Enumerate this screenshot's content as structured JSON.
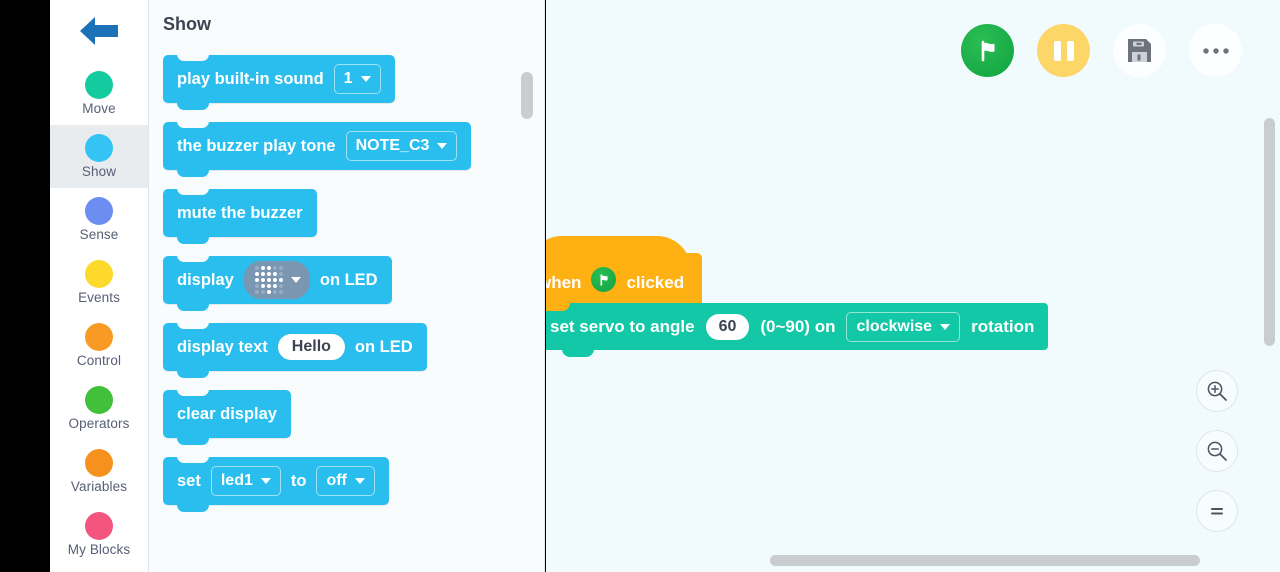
{
  "app": {
    "back_icon": "back-arrow-icon"
  },
  "sidebar": {
    "items": [
      {
        "label": "Move",
        "color": "#14ca9f",
        "active": false
      },
      {
        "label": "Show",
        "color": "#35c3f3",
        "active": true
      },
      {
        "label": "Sense",
        "color": "#6b8ef0",
        "active": false
      },
      {
        "label": "Events",
        "color": "#fcd92b",
        "active": false
      },
      {
        "label": "Control",
        "color": "#f99a24",
        "active": false
      },
      {
        "label": "Operators",
        "color": "#42bf3b",
        "active": false
      },
      {
        "label": "Variables",
        "color": "#f7911e",
        "active": false
      },
      {
        "label": "My Blocks",
        "color": "#f4557f",
        "active": false
      }
    ]
  },
  "palette": {
    "title": "Show",
    "blocks": [
      {
        "id": "play-built-in-sound",
        "pre": "play built-in sound",
        "field_type": "dropdown",
        "field_value": "1",
        "post": ""
      },
      {
        "id": "buzzer-play-tone",
        "pre": "the buzzer play tone",
        "field_type": "dropdown",
        "field_value": "NOTE_C3",
        "post": ""
      },
      {
        "id": "mute-the-buzzer",
        "pre": "mute the buzzer",
        "field_type": "none",
        "field_value": "",
        "post": ""
      },
      {
        "id": "display-on-led",
        "pre": "display",
        "field_type": "matrix",
        "field_value": "heart",
        "post": "on LED"
      },
      {
        "id": "display-text-on-led",
        "pre": "display text",
        "field_type": "text",
        "field_value": "Hello",
        "post": "on LED"
      },
      {
        "id": "clear-display",
        "pre": "clear display",
        "field_type": "none",
        "field_value": "",
        "post": ""
      },
      {
        "id": "set-led-to",
        "pre": "set",
        "field_type": "dual-dropdown",
        "field_value": "led1",
        "mid": "to",
        "field_value2": "off",
        "post": ""
      }
    ]
  },
  "toolbar": {
    "buttons": [
      {
        "name": "green-flag-button",
        "icon": "green-flag-icon"
      },
      {
        "name": "pause-button",
        "icon": "pause-icon"
      },
      {
        "name": "save-button",
        "icon": "floppy-disk-icon"
      },
      {
        "name": "more-options-button",
        "icon": "ellipsis-icon"
      }
    ]
  },
  "script": {
    "hat": {
      "pre": "when",
      "icon": "green-flag-icon",
      "post": "clicked"
    },
    "command": {
      "pre": "set servo to angle",
      "angle_value": "60",
      "range_label": "(0~90) on",
      "direction_value": "clockwise",
      "post": "rotation"
    }
  },
  "zoom_controls": [
    {
      "name": "zoom-in-button",
      "icon": "magnifier-plus-icon"
    },
    {
      "name": "zoom-out-button",
      "icon": "magnifier-minus-icon"
    },
    {
      "name": "zoom-reset-button",
      "icon": "equals-icon"
    }
  ],
  "colors": {
    "show_block": "#29beed",
    "move_block": "#13c8a6",
    "event_block": "#ffb013",
    "canvas_bg": "#f1fafd",
    "palette_bg": "#f9fcfd"
  }
}
